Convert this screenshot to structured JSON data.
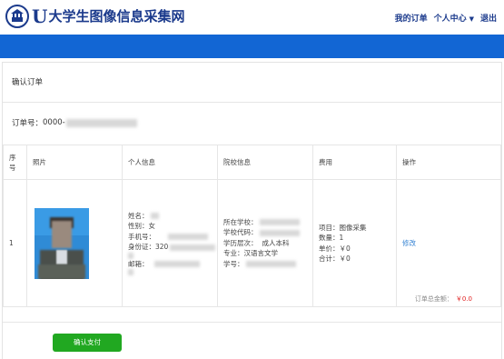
{
  "header": {
    "logo_u": "U",
    "site_title": "大学生图像信息采集网",
    "nav": {
      "my_orders": "我的订单",
      "user_center": "个人中心",
      "logout": "退出"
    }
  },
  "panel": {
    "title": "确认订单",
    "order_label": "订单号：",
    "order_prefix": "0000-"
  },
  "table": {
    "headers": [
      "序号",
      "照片",
      "个人信息",
      "院校信息",
      "费用",
      "操作"
    ],
    "row": {
      "index": "1",
      "person": {
        "name_label": "姓名：",
        "gender_label": "性别：",
        "gender_value": "女",
        "phone_label": "手机号：",
        "id_label": "身份证：",
        "id_prefix": "320",
        "email_label": "邮箱："
      },
      "school": {
        "school_label": "所在学校：",
        "code_label": "学校代码：",
        "level_label": "学历层次：",
        "level_value": "成人本科",
        "major_label": "专业：",
        "major_value": "汉语言文学",
        "student_no_label": "学号："
      },
      "fee": {
        "item_label": "项目：",
        "item_value": "图像采集",
        "qty_label": "数量：",
        "qty_value": "1",
        "price_label": "单价：",
        "price_value": "￥0",
        "total_label": "合计：",
        "total_value": "￥0"
      },
      "action": "修改"
    }
  },
  "summary": {
    "total_label": "订单总金额：",
    "total_amount": "￥0.0"
  },
  "pay_button": "确认支付",
  "colors": {
    "brand": "#1b3a8c",
    "bar": "#1266d4",
    "pay": "#21a821",
    "amount": "#e02020",
    "link": "#3a86d4"
  },
  "icons": {
    "logo": "university-emblem-icon",
    "caret": "caret-down-icon"
  }
}
